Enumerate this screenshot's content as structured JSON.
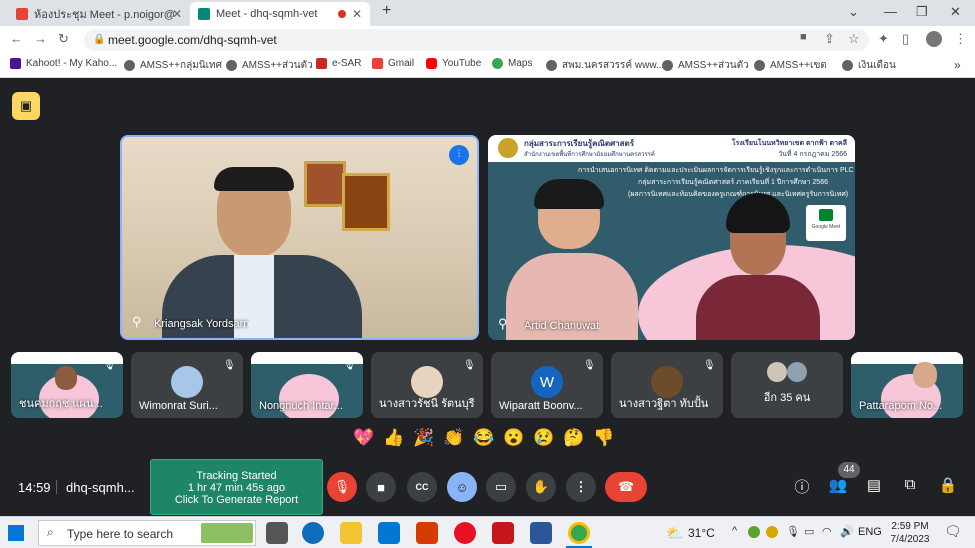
{
  "browser": {
    "tabs": [
      {
        "title": "ห้องประชุม Meet - p.noigor@gmai"
      },
      {
        "title": "Meet - dhq-sqmh-vet"
      }
    ],
    "new_tab": "+",
    "url": "meet.google.com/dhq-sqmh-vet",
    "bookmarks": [
      "Kahoot! - My Kaho...",
      "AMSS++กลุ่มนิเทศ",
      "AMSS++ส่วนตัว",
      "e-SAR",
      "Gmail",
      "YouTube",
      "Maps",
      "สพม.นครสวรรค์ www....",
      "AMSS++ส่วนตัว",
      "AMSS++เขต",
      "เงินเดือน"
    ]
  },
  "meet": {
    "main_tiles": [
      {
        "name": "Kriangsak Yordsarn"
      },
      {
        "name": "Artid Chanuwat",
        "slide": {
          "header": "กลุ่มสาระการเรียนรู้คณิตศาสตร์",
          "sub": "สำนักงานเขตพื้นที่การศึกษามัธยมศึกษานครสวรรค์",
          "school": "โรงเรียนโนนหวิทยาเขต ตากฟ้า ตาคลี",
          "date": "วันที่ 4 กรกฎาคม 2566",
          "l1": "การนำเสนอการนิเทศ ติดตามและประเมินผลการจัดการเรียนรู้เชิงรุกและการดำเนินการ PLC",
          "l2": "กลุ่มสาระการเรียนรู้คณิตศาสตร์ ภาคเรียนที่ 1 ปีการศึกษา 2566",
          "l3": "(ผลการนิเทศและท้อนคิดของครูเกณฑ์การนิเทศ และนิเทศครูรับการนิเทศ)",
          "logo": "Google Meet"
        }
      }
    ],
    "strip": [
      {
        "name": "ชนคมกฤช แผน..."
      },
      {
        "name": "Wimonrat Suri..."
      },
      {
        "name": "Nongnuch Intar..."
      },
      {
        "name": "นางสาวรัชนี รัตนบุรี"
      },
      {
        "name": "Wiparatt Boonv...",
        "initial": "W"
      },
      {
        "name": "นางสาวฐิตา ทับปั้น"
      },
      {
        "name": "อีก 35 คน"
      },
      {
        "name": "Pattarapom No..."
      }
    ],
    "reactions": [
      "💖",
      "👍",
      "🎉",
      "👏",
      "😂",
      "😮",
      "😢",
      "🤔",
      "👎"
    ],
    "time": "14:59",
    "code": "dhq-sqmh...",
    "tracking": {
      "l1": "Tracking Started",
      "l2": "1 hr 47 min 45s ago",
      "l3": "Click To Generate Report"
    },
    "people_count": "44"
  },
  "taskbar": {
    "search": "Type here to search",
    "temp": "31°C",
    "lang": "ENG",
    "time": "2:59 PM",
    "date": "7/4/2023"
  }
}
